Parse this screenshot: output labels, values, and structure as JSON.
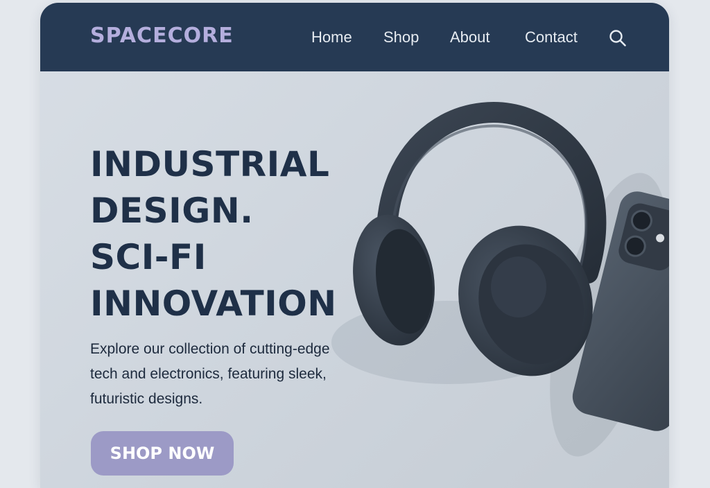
{
  "brand": {
    "name": "SPACECORE"
  },
  "nav": {
    "items": [
      {
        "label": "Home"
      },
      {
        "label": "Shop"
      },
      {
        "label": "About"
      },
      {
        "label": "Contact"
      }
    ],
    "search_icon": "search-icon"
  },
  "hero": {
    "title_lines": [
      "INDUSTRIAL",
      "DESIGN.",
      "SCI-FI",
      "INNOVATION"
    ],
    "description": "Explore our collection of cutting-edge tech and electronics, featuring sleek, futuristic designs.",
    "cta_label": "SHOP NOW",
    "image_subjects": [
      "headphones",
      "smartphone"
    ]
  },
  "colors": {
    "nav_background": "#263a54",
    "logo": "#b4aedd",
    "heading": "#1f3048",
    "cta_background": "#9c9ac6",
    "hero_background": "#d3d9e0"
  }
}
